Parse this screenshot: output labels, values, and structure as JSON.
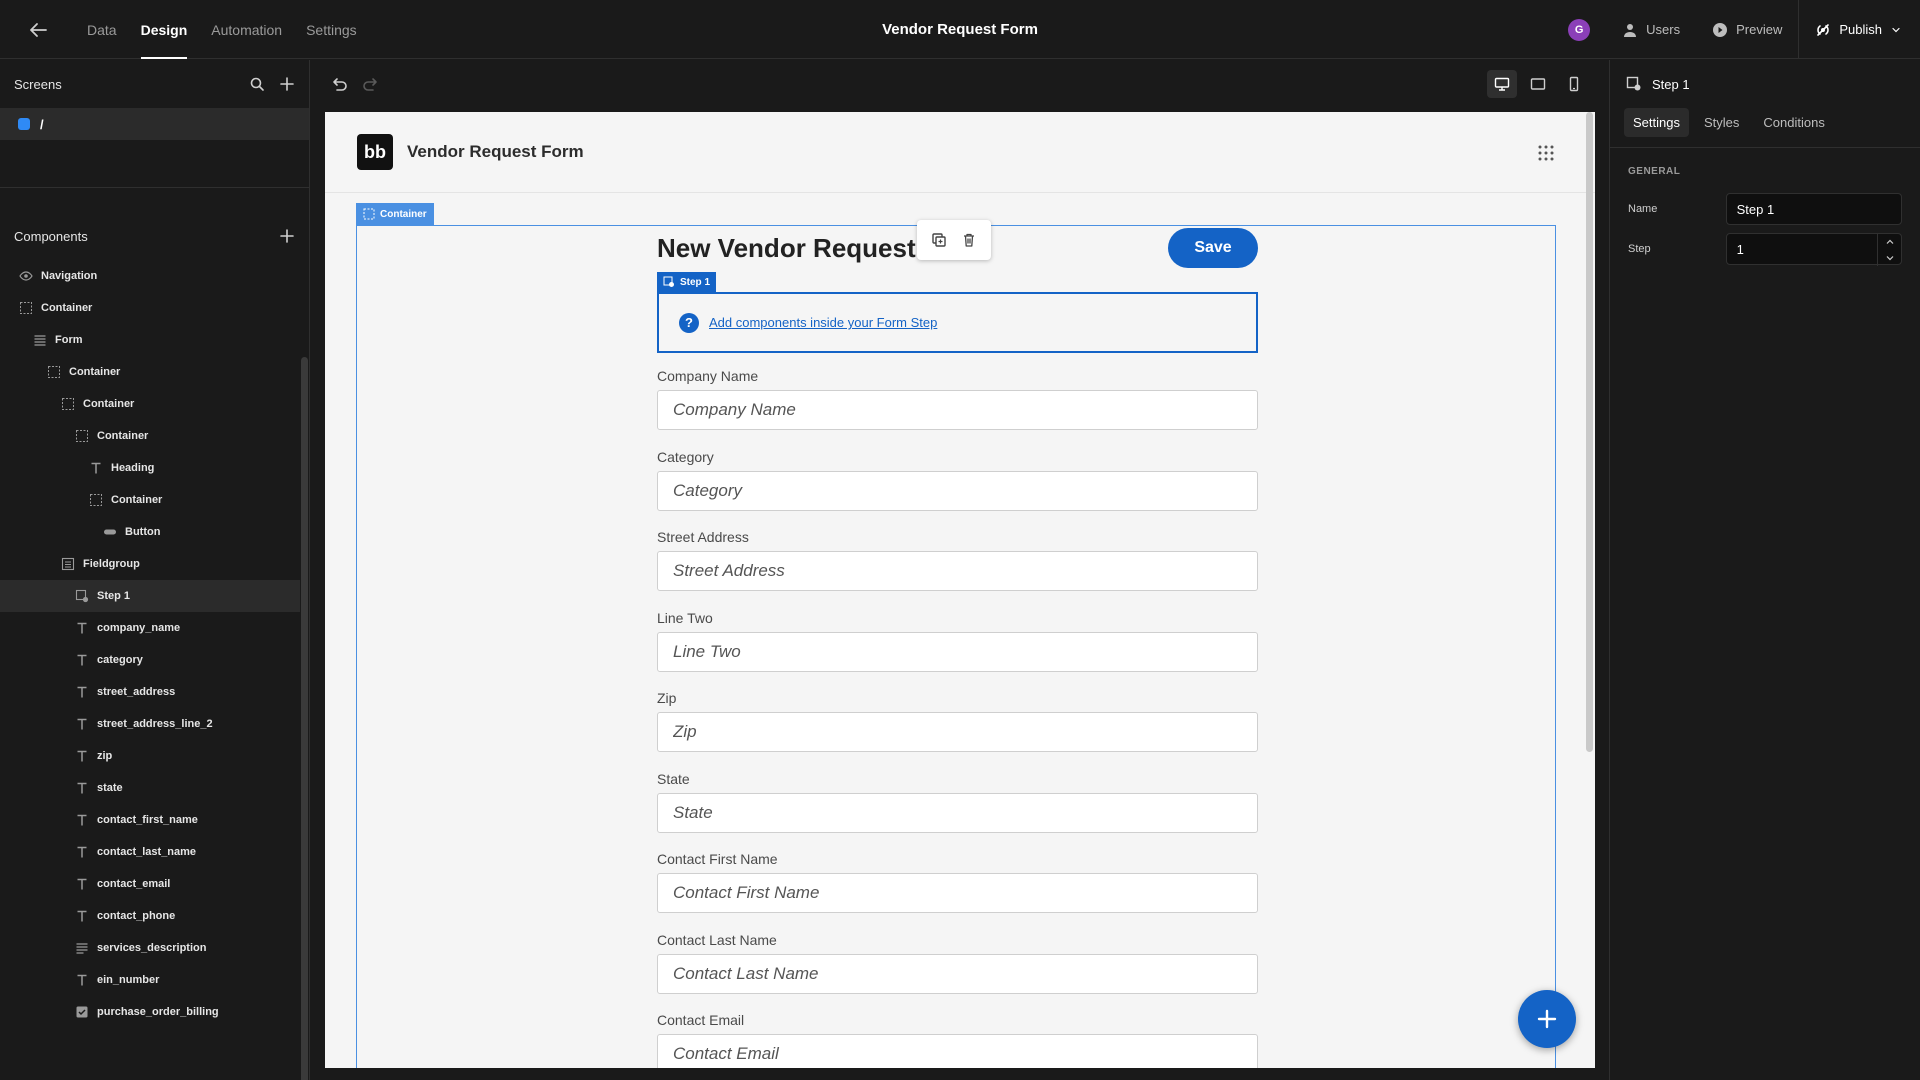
{
  "topbar": {
    "tabs": [
      {
        "label": "Data",
        "active": false
      },
      {
        "label": "Design",
        "active": true
      },
      {
        "label": "Automation",
        "active": false
      },
      {
        "label": "Settings",
        "active": false
      }
    ],
    "app_title": "Vendor Request Form",
    "avatar_initial": "G",
    "users_label": "Users",
    "preview_label": "Preview",
    "publish_label": "Publish"
  },
  "screens": {
    "title": "Screens",
    "items": [
      {
        "route": "/"
      }
    ]
  },
  "components": {
    "title": "Components",
    "items": [
      {
        "label": "Navigation",
        "icon": "eye-icon",
        "depth": 0
      },
      {
        "label": "Container",
        "icon": "container-icon",
        "depth": 0
      },
      {
        "label": "Form",
        "icon": "form-icon",
        "depth": 1
      },
      {
        "label": "Container",
        "icon": "container-icon",
        "depth": 2
      },
      {
        "label": "Container",
        "icon": "container-icon",
        "depth": 3
      },
      {
        "label": "Container",
        "icon": "container-icon",
        "depth": 4
      },
      {
        "label": "Heading",
        "icon": "text-icon",
        "depth": 5
      },
      {
        "label": "Container",
        "icon": "container-icon",
        "depth": 5
      },
      {
        "label": "Button",
        "icon": "button-icon",
        "depth": 6
      },
      {
        "label": "Fieldgroup",
        "icon": "fieldgroup-icon",
        "depth": 3
      },
      {
        "label": "Step 1",
        "icon": "step-icon",
        "depth": 4,
        "selected": true
      },
      {
        "label": "company_name",
        "icon": "text-icon",
        "depth": 4
      },
      {
        "label": "category",
        "icon": "text-icon",
        "depth": 4
      },
      {
        "label": "street_address",
        "icon": "text-icon",
        "depth": 4
      },
      {
        "label": "street_address_line_2",
        "icon": "text-icon",
        "depth": 4
      },
      {
        "label": "zip",
        "icon": "text-icon",
        "depth": 4
      },
      {
        "label": "state",
        "icon": "text-icon",
        "depth": 4
      },
      {
        "label": "contact_first_name",
        "icon": "text-icon",
        "depth": 4
      },
      {
        "label": "contact_last_name",
        "icon": "text-icon",
        "depth": 4
      },
      {
        "label": "contact_email",
        "icon": "text-icon",
        "depth": 4
      },
      {
        "label": "contact_phone",
        "icon": "text-icon",
        "depth": 4
      },
      {
        "label": "services_description",
        "icon": "longtext-icon",
        "depth": 4
      },
      {
        "label": "ein_number",
        "icon": "text-icon",
        "depth": 4
      },
      {
        "label": "purchase_order_billing",
        "icon": "checkbox-icon",
        "depth": 4
      }
    ]
  },
  "preview": {
    "nav_title": "Vendor Request Form",
    "logo_text": "bb",
    "container_tag": "Container",
    "heading": "New Vendor Request",
    "save_label": "Save",
    "step_tag": "Step 1",
    "step_hint": "Add components inside your Form Step",
    "fields": [
      {
        "label": "Company Name",
        "placeholder": "Company Name"
      },
      {
        "label": "Category",
        "placeholder": "Category"
      },
      {
        "label": "Street Address",
        "placeholder": "Street Address"
      },
      {
        "label": "Line Two",
        "placeholder": "Line Two"
      },
      {
        "label": "Zip",
        "placeholder": "Zip"
      },
      {
        "label": "State",
        "placeholder": "State"
      },
      {
        "label": "Contact First Name",
        "placeholder": "Contact First Name"
      },
      {
        "label": "Contact Last Name",
        "placeholder": "Contact Last Name"
      },
      {
        "label": "Contact Email",
        "placeholder": "Contact Email"
      }
    ]
  },
  "settings_panel": {
    "component_name": "Step 1",
    "tabs": [
      {
        "label": "Settings",
        "active": true
      },
      {
        "label": "Styles",
        "active": false
      },
      {
        "label": "Conditions",
        "active": false
      }
    ],
    "section_title": "GENERAL",
    "name_label": "Name",
    "name_value": "Step 1",
    "step_label": "Step",
    "step_value": "1"
  },
  "colors": {
    "accent": "#1463c6",
    "container_outline": "#4a90e2",
    "avatar": "#8b3fb8"
  }
}
